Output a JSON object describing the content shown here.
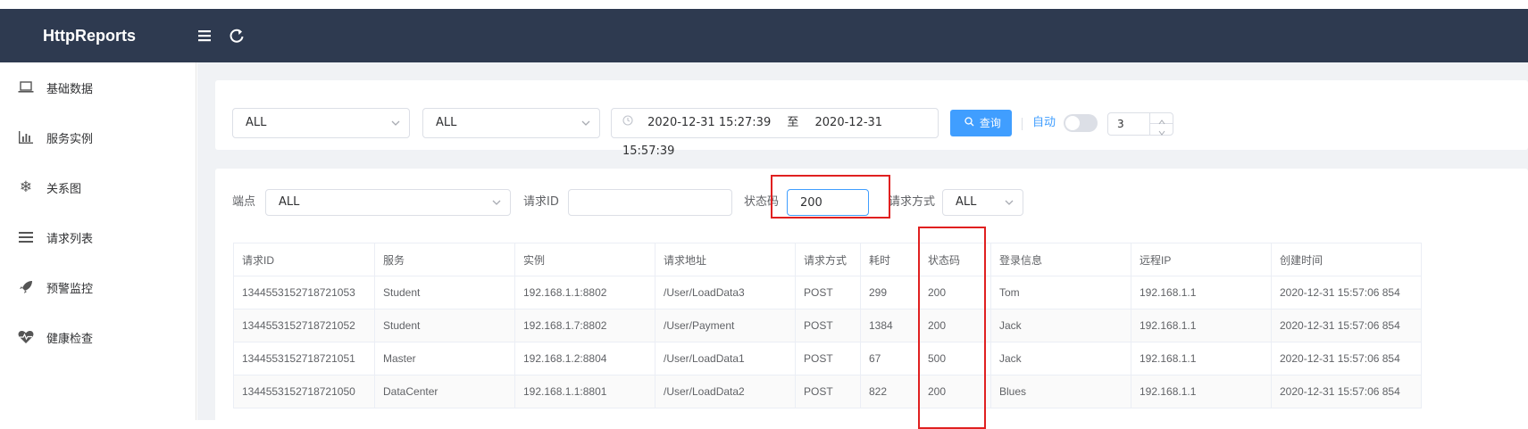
{
  "app": {
    "title": "HttpReports"
  },
  "topbar": {
    "menu_icon": "menu-toggle-icon",
    "refresh_icon": "refresh-icon"
  },
  "sidebar": {
    "items": [
      {
        "label": "基础数据",
        "icon": "laptop-icon"
      },
      {
        "label": "服务实例",
        "icon": "bar-chart-icon"
      },
      {
        "label": "关系图",
        "icon": "snowflake-icon"
      },
      {
        "label": "请求列表",
        "icon": "list-icon"
      },
      {
        "label": "预警监控",
        "icon": "rocket-icon"
      },
      {
        "label": "健康检查",
        "icon": "heartbeat-icon"
      }
    ]
  },
  "filters": {
    "service_select": "ALL",
    "instance_select": "ALL",
    "date_start": "2020-12-31 15:27:39",
    "date_separator": "至",
    "date_end": "2020-12-31 15:57:39",
    "query_button": "查询",
    "auto_label": "自动",
    "auto_enabled": false,
    "interval_value": "3"
  },
  "search": {
    "endpoint_label": "端点",
    "endpoint_value": "ALL",
    "request_id_label": "请求ID",
    "request_id_value": "",
    "status_code_label": "状态码",
    "status_code_value": "200",
    "method_label": "请求方式",
    "method_value": "ALL"
  },
  "table": {
    "headers": [
      "请求ID",
      "服务",
      "实例",
      "请求地址",
      "请求方式",
      "耗时",
      "状态码",
      "登录信息",
      "远程IP",
      "创建时间"
    ],
    "rows": [
      [
        "1344553152718721053",
        "Student",
        "192.168.1.1:8802",
        "/User/LoadData3",
        "POST",
        "299",
        "200",
        "Tom",
        "192.168.1.1",
        "2020-12-31 15:57:06 854"
      ],
      [
        "1344553152718721052",
        "Student",
        "192.168.1.7:8802",
        "/User/Payment",
        "POST",
        "1384",
        "200",
        "Jack",
        "192.168.1.1",
        "2020-12-31 15:57:06 854"
      ],
      [
        "1344553152718721051",
        "Master",
        "192.168.1.2:8804",
        "/User/LoadData1",
        "POST",
        "67",
        "500",
        "Jack",
        "192.168.1.1",
        "2020-12-31 15:57:06 854"
      ],
      [
        "1344553152718721050",
        "DataCenter",
        "192.168.1.1:8801",
        "/User/LoadData2",
        "POST",
        "822",
        "200",
        "Blues",
        "192.168.1.1",
        "2020-12-31 15:57:06 854"
      ]
    ]
  },
  "colors": {
    "topbar": "#2e3a50",
    "primary": "#409eff",
    "highlight": "#e02020"
  }
}
